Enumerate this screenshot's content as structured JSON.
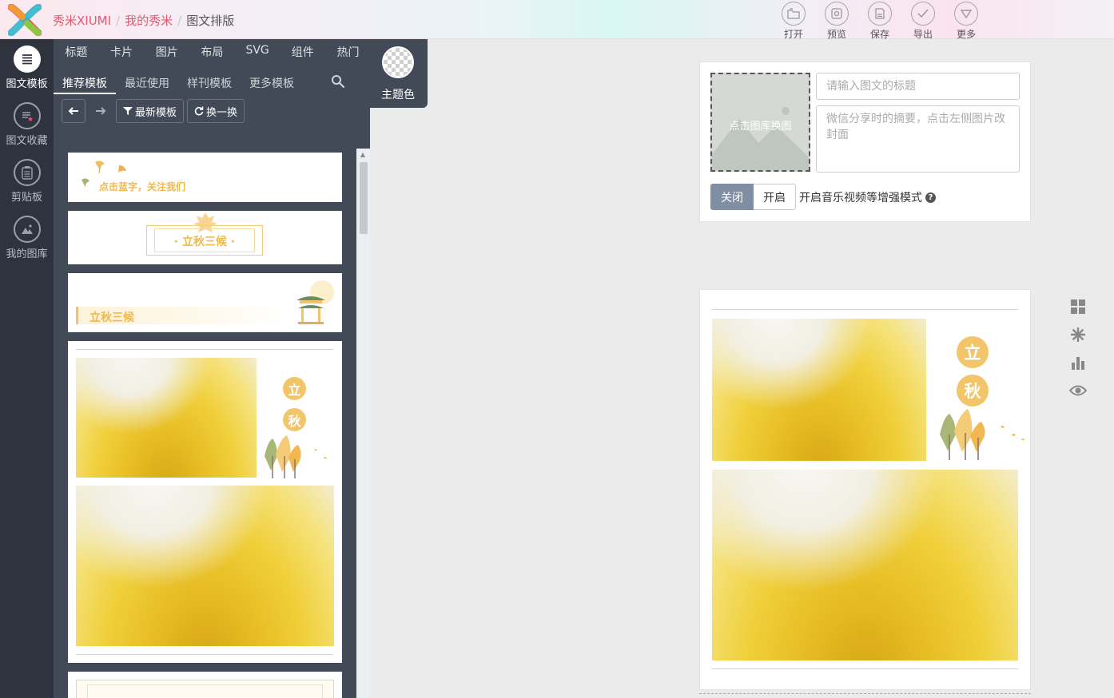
{
  "header": {
    "breadcrumb": [
      "秀米XIUMI",
      "我的秀米",
      "图文排版"
    ],
    "separator": "/",
    "actions": [
      {
        "label": "打开",
        "icon": "folder-icon"
      },
      {
        "label": "预览",
        "icon": "preview-icon"
      },
      {
        "label": "保存",
        "icon": "save-icon"
      },
      {
        "label": "导出",
        "icon": "check-icon"
      },
      {
        "label": "更多",
        "icon": "more-icon"
      }
    ]
  },
  "leftbar": {
    "items": [
      {
        "label": "图文模板",
        "icon": "list-icon",
        "active": true
      },
      {
        "label": "图文收藏",
        "icon": "favorites-icon"
      },
      {
        "label": "剪贴板",
        "icon": "clipboard-icon"
      },
      {
        "label": "我的图库",
        "icon": "gallery-icon"
      }
    ]
  },
  "panel": {
    "categories": [
      "标题",
      "卡片",
      "图片",
      "布局",
      "SVG",
      "组件",
      "热门"
    ],
    "subtabs": [
      "推荐模板",
      "最近使用",
      "样刊模板",
      "更多模板"
    ],
    "active_subtab": "推荐模板",
    "theme_label": "主题色",
    "toolbar": {
      "newest": "最新模板",
      "shuffle": "换一换"
    }
  },
  "templates": {
    "t1_text": "点击蓝字，关注我们",
    "t2_text": "· 立秋三候 ·",
    "t3_text": "立秋三候",
    "t4_chars": [
      "立",
      "秋"
    ]
  },
  "article": {
    "cover_text": "点击图库换图",
    "title_placeholder": "请输入图文的标题",
    "summary_placeholder": "微信分享时的摘要，点击左侧图片改封面",
    "toggle_off": "关闭",
    "toggle_on": "开启",
    "enhance_text": "开启音乐视频等增强模式",
    "help_glyph": "?",
    "content_chars": [
      "立",
      "秋"
    ]
  },
  "side_tools": [
    "grid-icon",
    "gear-icon",
    "chart-icon",
    "eye-icon"
  ],
  "colors": {
    "brand": "#e25a72",
    "panel": "#424957",
    "sidebar": "#2e333d",
    "accent_gold": "#f2c56b"
  }
}
